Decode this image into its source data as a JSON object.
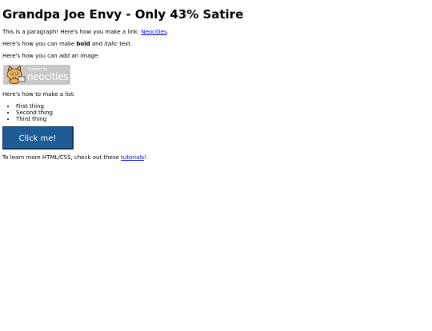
{
  "heading": "Grandpa Joe Envy - Only 43% Satire",
  "intro": {
    "before": "This is a paragraph! Here's how you make a link: ",
    "link": "Neocities",
    "after": "."
  },
  "formatting": {
    "before": "Here's how you can make ",
    "bold": "bold",
    "middle": " and ",
    "italic": "italic",
    "after": " text."
  },
  "image_caption": "Here's how you can add an image:",
  "badge": {
    "small_text": "hosted by",
    "brand_text": "neocities",
    "icon": "neocities-cat-icon"
  },
  "list_caption": "Here's how to make a list:",
  "list_items": [
    "First thing",
    "Second thing",
    "Third thing"
  ],
  "button_label": "Click me!",
  "footer": {
    "before": "To learn more HTML/CSS, check out these ",
    "link": "tutorials",
    "after": "!"
  },
  "colors": {
    "button": "#1e5c96",
    "link": "#0000ee",
    "badge_bg": "#c8c8c8"
  }
}
